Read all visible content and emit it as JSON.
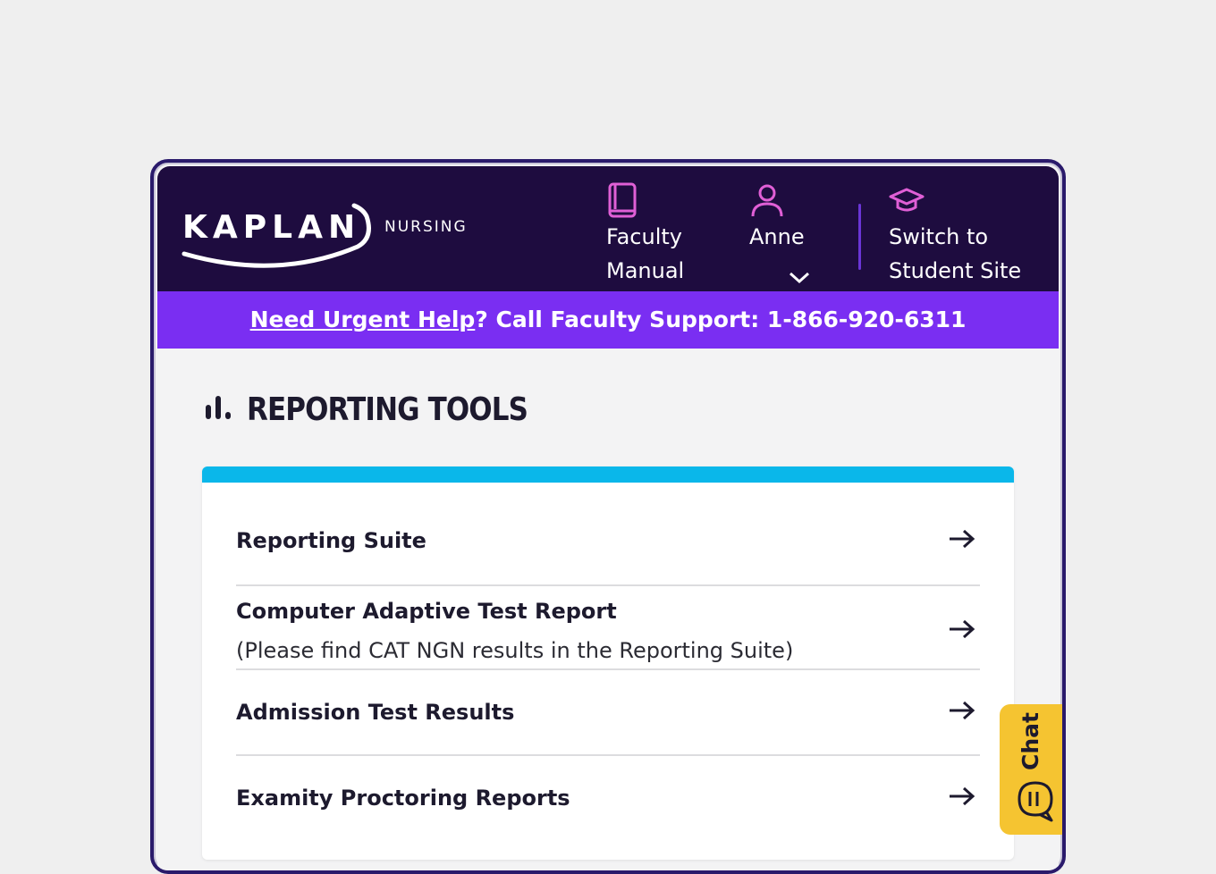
{
  "header": {
    "logo_text": "KAPLAN",
    "brand_sub": "NURSING",
    "nav": {
      "faculty_line1": "Faculty",
      "faculty_line2": "Manual",
      "user_name": "Anne",
      "student_line1": "Switch to",
      "student_line2": "Student Site"
    },
    "icons": [
      "book-icon",
      "user-icon",
      "chevron-down-icon",
      "graduation-cap-icon"
    ]
  },
  "banner": {
    "link_text": "Need Urgent Help",
    "rest_text": "? Call Faculty Support: 1-866-920-6311"
  },
  "section": {
    "title": "REPORTING TOOLS",
    "icon": "bar-chart-icon"
  },
  "items": [
    {
      "label": "Reporting Suite",
      "sub": ""
    },
    {
      "label": "Computer Adaptive Test Report",
      "sub": "(Please find CAT NGN results in the Reporting Suite)"
    },
    {
      "label": "Admission Test Results",
      "sub": ""
    },
    {
      "label": "Examity Proctoring Reports",
      "sub": ""
    }
  ],
  "chat": {
    "label": "Chat",
    "icon": "chat-bubble-icon"
  },
  "colors": {
    "header_bg": "#1e0c3f",
    "banner_bg": "#7a2ef2",
    "accent_pink": "#e05fd6",
    "card_accent": "#0ab7ea",
    "chat_bg": "#f5c431"
  }
}
